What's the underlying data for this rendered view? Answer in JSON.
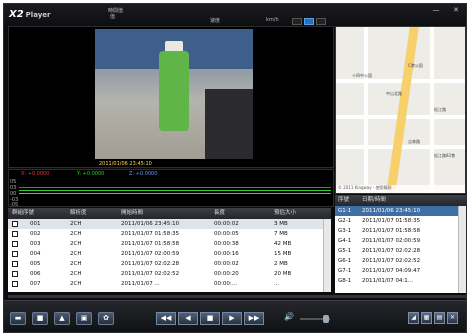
{
  "app": {
    "logo_main": "X2",
    "logo_sub": "Player"
  },
  "header": {
    "time_label": "時間值",
    "time_sub": "值",
    "speed_label": "速度",
    "speed_unit": "km/h",
    "close": "✕",
    "minimize": "—"
  },
  "video": {
    "osd_text": "2011/01/06  23:45:10"
  },
  "graph": {
    "x_label": "X: +0.0000",
    "y_label": "Y: +0.0000",
    "z_label": "Z: +0.0000",
    "scale_labels": [
      "05",
      "03",
      "00",
      "-03",
      "-05"
    ]
  },
  "map": {
    "labels": [
      "十四中公園",
      "C港公園",
      "松江路",
      "吉林路",
      "中山北路",
      "松江路82巷"
    ],
    "footer": "© 2011 Kingway - 使用條款"
  },
  "table": {
    "columns": [
      "群組序號",
      "解析度",
      "開始時間",
      "長度",
      "預估大小"
    ],
    "rows": [
      {
        "id": "001",
        "res": "2CH",
        "start": "2011/01/06 23:45:10",
        "len": "00:00:02",
        "size": "3 MB"
      },
      {
        "id": "002",
        "res": "2CH",
        "start": "2011/01/07 01:58:35",
        "len": "00:00:05",
        "size": "7 MB"
      },
      {
        "id": "003",
        "res": "2CH",
        "start": "2011/01/07 01:58:58",
        "len": "00:00:38",
        "size": "42 MB"
      },
      {
        "id": "004",
        "res": "2CH",
        "start": "2011/01/07 02:00:59",
        "len": "00:00:16",
        "size": "15 MB"
      },
      {
        "id": "005",
        "res": "2CH",
        "start": "2011/01/07 02:02:28",
        "len": "00:00:02",
        "size": "2 MB"
      },
      {
        "id": "006",
        "res": "2CH",
        "start": "2011/01/07 02:02:52",
        "len": "00:00:20",
        "size": "20 MB"
      },
      {
        "id": "007",
        "res": "2CH",
        "start": "2011/01/07 ...",
        "len": "00:00:...",
        "size": "..."
      }
    ]
  },
  "list": {
    "columns": [
      "序號",
      "日期/時間"
    ],
    "rows": [
      {
        "id": "G1-1",
        "time": "2011/01/06 23:45:10"
      },
      {
        "id": "G2-1",
        "time": "2011/01/07 01:58:35"
      },
      {
        "id": "G3-1",
        "time": "2011/01/07 01:58:58"
      },
      {
        "id": "G4-1",
        "time": "2011/01/07 02:00:59"
      },
      {
        "id": "G5-1",
        "time": "2011/01/07 02:02:28"
      },
      {
        "id": "G6-1",
        "time": "2011/01/07 02:02:52"
      },
      {
        "id": "G7-1",
        "time": "2011/01/07 04:09:47"
      },
      {
        "id": "G8-1",
        "time": "2011/01/07 04:1..."
      }
    ]
  },
  "controls": {
    "left": [
      "▬",
      "■",
      "▲",
      "▣",
      "✿"
    ],
    "playback": [
      "◀◀",
      "◀",
      "■",
      "▶",
      "▶▶"
    ],
    "volume_icon": "🔊",
    "right": [
      "◢",
      "▦",
      "▤",
      "✕"
    ]
  }
}
